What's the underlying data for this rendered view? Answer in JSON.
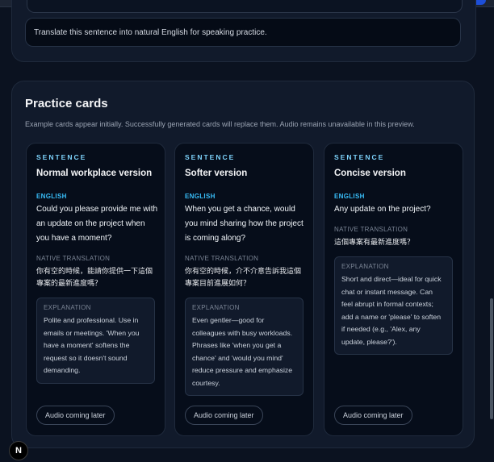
{
  "prompt_text": "Translate this sentence into natural English for speaking practice.",
  "practice": {
    "title": "Practice cards",
    "subtitle": "Example cards appear initially. Successfully generated cards will replace them. Audio remains unavailable in this preview.",
    "cards": [
      {
        "kicker": "SENTENCE",
        "title": "Normal workplace version",
        "english_label": "ENGLISH",
        "english": "Could you please provide me with an update on the project when you have a moment?",
        "native_label": "NATIVE TRANSLATION",
        "native": "你有空的時候，能請你提供一下這個專案的最新進度嗎？",
        "explanation_label": "EXPLANATION",
        "explanation": "Polite and professional. Use in emails or meetings. 'When you have a moment' softens the request so it doesn't sound demanding.",
        "audio_label": "Audio coming later"
      },
      {
        "kicker": "SENTENCE",
        "title": "Softer version",
        "english_label": "ENGLISH",
        "english": "When you get a chance, would you mind sharing how the project is coming along?",
        "native_label": "NATIVE TRANSLATION",
        "native": "你有空的時候，介不介意告訴我這個專案目前進展如何？",
        "explanation_label": "EXPLANATION",
        "explanation": "Even gentler—good for colleagues with busy workloads. Phrases like 'when you get a chance' and 'would you mind' reduce pressure and emphasize courtesy.",
        "audio_label": "Audio coming later"
      },
      {
        "kicker": "SENTENCE",
        "title": "Concise version",
        "english_label": "ENGLISH",
        "english": "Any update on the project?",
        "native_label": "NATIVE TRANSLATION",
        "native": "這個專案有最新進度嗎？",
        "explanation_label": "EXPLANATION",
        "explanation": "Short and direct—ideal for quick chat or instant message. Can feel abrupt in formal contexts; add a name or 'please' to soften if needed (e.g., 'Alex, any update, please?').",
        "audio_label": "Audio coming later"
      }
    ]
  },
  "badge": {
    "letter": "N"
  }
}
